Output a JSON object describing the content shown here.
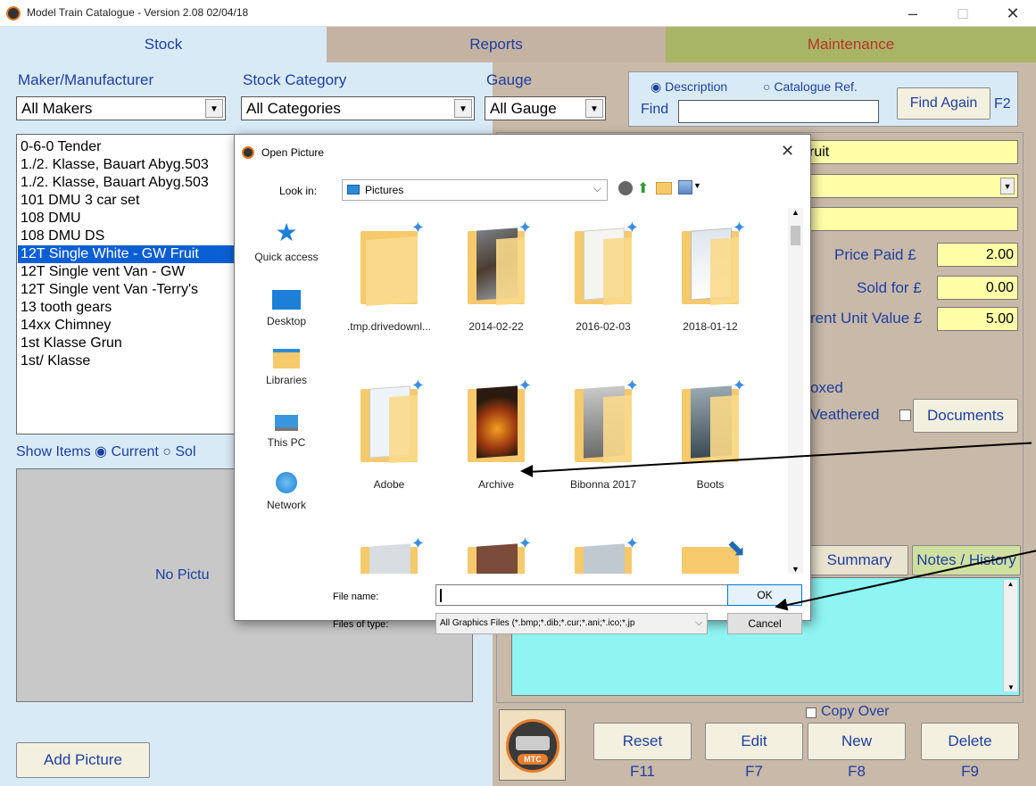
{
  "window": {
    "title": "Model Train Catalogue - Version 2.08 02/04/18",
    "min": "–",
    "max": "□",
    "close": "✕"
  },
  "tabs": [
    {
      "label": "Stock",
      "bg": "#d9eaf7",
      "color": "#1e3fa0"
    },
    {
      "label": "Reports",
      "bg": "#c4b3a2",
      "color": "#1e3fa0"
    },
    {
      "label": "Maintenance",
      "bg": "#a9b566",
      "color": "#b5342a"
    }
  ],
  "filters": {
    "maker_label": "Maker/Manufacturer",
    "maker_value": "All Makers",
    "category_label": "Stock Category",
    "category_value": "All Categories",
    "gauge_label": "Gauge",
    "gauge_value": "All Gauge"
  },
  "search": {
    "opt_description": "Description",
    "opt_catref": "Catalogue Ref.",
    "find_label": "Find",
    "find_value": "",
    "find_again": "Find Again",
    "find_key": "F2"
  },
  "stock_list": [
    "0-6-0 Tender",
    "1./2. Klasse, Bauart Abyg.503",
    "1./2. Klasse, Bauart Abyg.503",
    "101 DMU 3 car set",
    "108 DMU",
    "108 DMU DS",
    "12T Single White - GW Fruit",
    "12T Single vent Van - GW",
    "12T Single vent Van -Terry's",
    "13 tooth gears",
    "14xx Chimney",
    "1st Klasse Grun",
    "1st/ Klasse"
  ],
  "show_items": {
    "label": "Show Items",
    "current": "Current",
    "sold": "Sol"
  },
  "picture": {
    "no_picture": "No Pictu",
    "add_picture": "Add Picture"
  },
  "detail": {
    "name_value": "ruit",
    "price_paid_label": "Price Paid £",
    "price_paid": "2.00",
    "sold_for_label": "Sold for £",
    "sold_for": "0.00",
    "unit_value_label": "rent Unit Value £",
    "unit_value": "5.00",
    "boxed_label": "oxed",
    "weathered_label": "Veathered",
    "documents": "Documents",
    "summary": "Summary",
    "notes": "Notes / History",
    "copy_over": "Copy Over"
  },
  "actions": [
    {
      "label": "Reset",
      "key": "F11"
    },
    {
      "label": "Edit",
      "key": "F7"
    },
    {
      "label": "New",
      "key": "F8"
    },
    {
      "label": "Delete",
      "key": "F9"
    }
  ],
  "logo_text": "MTC",
  "dialog": {
    "title": "Open Picture",
    "close": "✕",
    "look_in_label": "Look in:",
    "look_in_value": "Pictures",
    "nav": [
      "Quick access",
      "Desktop",
      "Libraries",
      "This PC",
      "Network"
    ],
    "folders_row1": [
      ".tmp.drivedownl...",
      "2014-02-22",
      "2016-02-03",
      "2018-01-12"
    ],
    "folders_row2": [
      "Adobe",
      "Archive",
      "Bibonna 2017",
      "Boots"
    ],
    "file_name_label": "File name:",
    "file_name_value": "",
    "files_type_label": "Files of type:",
    "files_type_value": "All Graphics Files (*.bmp;*.dib;*.cur;*.ani;*.ico;*.jp",
    "ok": "OK",
    "cancel": "Cancel"
  }
}
